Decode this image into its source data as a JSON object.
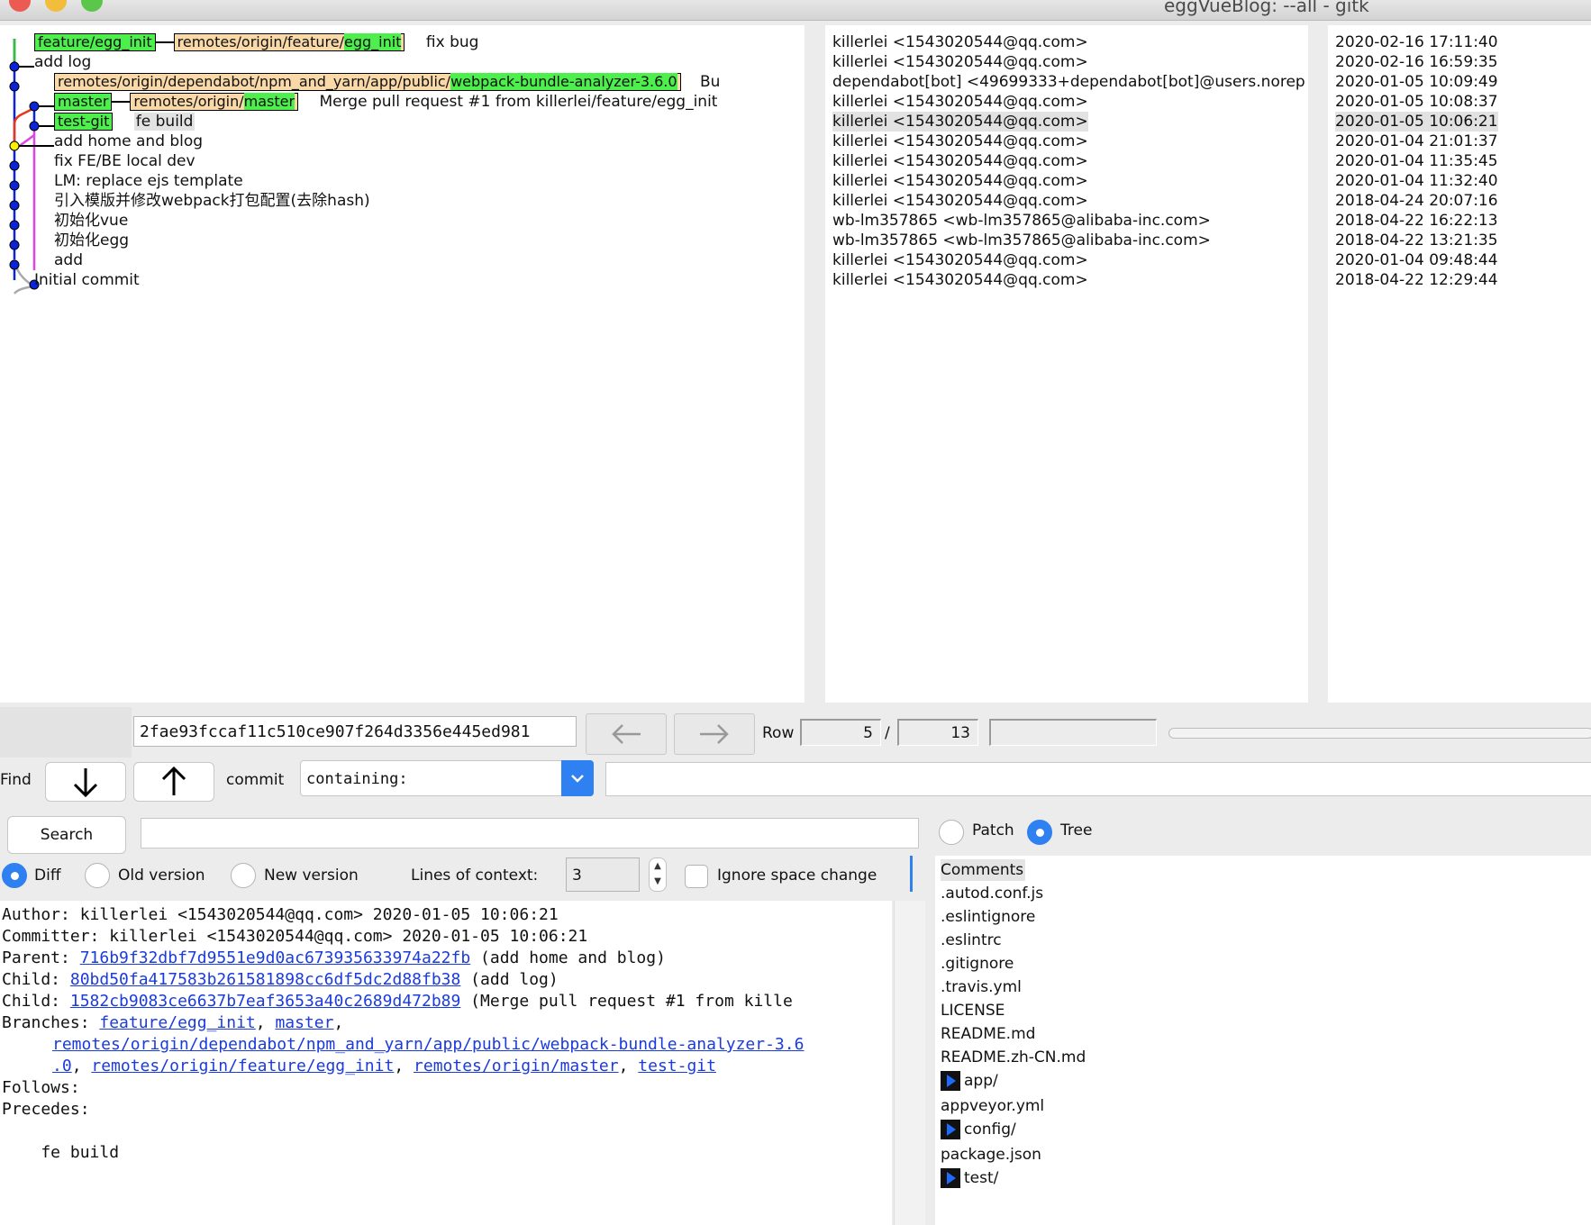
{
  "window": {
    "title": "eggVueBlog: --all - gitk"
  },
  "commits": [
    {
      "refs": [
        {
          "label": "feature/egg_init",
          "style": "green"
        },
        {
          "label_prefix": "remotes/origin/feature/",
          "label_main": "egg_init",
          "style": "peach"
        }
      ],
      "message": "fix bug",
      "author": "killerlei <1543020544@qq.com>",
      "date": "2020-02-16 17:11:40"
    },
    {
      "refs": [],
      "message": "add log",
      "author": "killerlei <1543020544@qq.com>",
      "date": "2020-02-16 16:59:35"
    },
    {
      "refs": [
        {
          "label_prefix": "remotes/origin/dependabot/npm_and_yarn/app/public/",
          "label_main": "webpack-bundle-analyzer-3.6.0",
          "style": "peach"
        }
      ],
      "message": "Bu",
      "author": "dependabot[bot] <49699333+dependabot[bot]@users.norep",
      "date": "2020-01-05 10:09:49"
    },
    {
      "refs": [
        {
          "label": "master",
          "style": "green"
        },
        {
          "label_prefix": "remotes/origin/",
          "label_main": "master",
          "style": "peach"
        }
      ],
      "message": "Merge pull request #1 from killerlei/feature/egg_init",
      "author": "killerlei <1543020544@qq.com>",
      "date": "2020-01-05 10:08:37"
    },
    {
      "refs": [
        {
          "label": "test-git",
          "style": "green"
        }
      ],
      "message": "fe build",
      "author": "killerlei <1543020544@qq.com>",
      "date": "2020-01-05 10:06:21",
      "selected": true
    },
    {
      "refs": [],
      "message": "add home and blog",
      "author": "killerlei <1543020544@qq.com>",
      "date": "2020-01-04 21:01:37"
    },
    {
      "refs": [],
      "message": "fix FE/BE local dev",
      "author": "killerlei <1543020544@qq.com>",
      "date": "2020-01-04 11:35:45"
    },
    {
      "refs": [],
      "message": "LM: replace ejs template",
      "author": "killerlei <1543020544@qq.com>",
      "date": "2020-01-04 11:32:40"
    },
    {
      "refs": [],
      "message": "引入模版并修改webpack打包配置(去除hash)",
      "author": "killerlei <1543020544@qq.com>",
      "date": "2018-04-24 20:07:16"
    },
    {
      "refs": [],
      "message": "初始化vue",
      "author": "wb-lm357865 <wb-lm357865@alibaba-inc.com>",
      "date": "2018-04-22 16:22:13"
    },
    {
      "refs": [],
      "message": "初始化egg",
      "author": "wb-lm357865 <wb-lm357865@alibaba-inc.com>",
      "date": "2018-04-22 13:21:35"
    },
    {
      "refs": [],
      "message": "add",
      "author": "killerlei <1543020544@qq.com>",
      "date": "2020-01-04 09:48:44"
    },
    {
      "refs": [],
      "message": "Initial commit",
      "author": "killerlei <1543020544@qq.com>",
      "date": "2018-04-22 12:29:44"
    }
  ],
  "toolbar": {
    "sha": "2fae93fccaf11c510ce907f264d3356e445ed981",
    "row_label": "Row",
    "row_current": "5",
    "row_sep": "/",
    "row_total": "13"
  },
  "find": {
    "label": "Find",
    "commit_label": "commit",
    "mode": "containing:",
    "search_button": "Search"
  },
  "view_options": {
    "patch": "Patch",
    "tree": "Tree",
    "selected_view": "Tree",
    "diff": "Diff",
    "old_version": "Old version",
    "new_version": "New version",
    "selected_diff": "Diff",
    "lines_context_label": "Lines of context:",
    "lines_context_value": "3",
    "ignore_space_label": "Ignore space change",
    "ignore_space_checked": false
  },
  "details": {
    "author": "Author: killerlei <1543020544@qq.com>  2020-01-05 10:06:21",
    "committer": "Committer: killerlei <1543020544@qq.com>  2020-01-05 10:06:21",
    "parent_label": "Parent: ",
    "parent_sha": "716b9f32dbf7d9551e9d0ac673935633974a22fb",
    "parent_msg": " (add home and blog)",
    "child1_label": "Child:  ",
    "child1_sha": "80bd50fa417583b261581898cc6df5dc2d88fb38",
    "child1_msg": " (add log)",
    "child2_label": "Child:  ",
    "child2_sha": "1582cb9083ce6637b7eaf3653a40c2689d472b89",
    "child2_msg": " (Merge pull request #1 from kille",
    "branches_label": "Branches: ",
    "branch1": "feature/egg_init",
    "branch2": "master",
    "branch3a": "remotes/origin/dependabot/npm_and_yarn/app/public/webpack-bundle-analyzer-3.6",
    "branch3b": ".0",
    "branch4": "remotes/origin/feature/egg_init",
    "branch5": "remotes/origin/master",
    "branch6": "test-git",
    "follows": "Follows:",
    "precedes": "Precedes:",
    "message": "    fe build"
  },
  "tree": {
    "items": [
      {
        "name": "Comments",
        "type": "header"
      },
      {
        "name": ".autod.conf.js",
        "type": "file"
      },
      {
        "name": ".eslintignore",
        "type": "file"
      },
      {
        "name": ".eslintrc",
        "type": "file"
      },
      {
        "name": ".gitignore",
        "type": "file"
      },
      {
        "name": ".travis.yml",
        "type": "file"
      },
      {
        "name": "LICENSE",
        "type": "file"
      },
      {
        "name": "README.md",
        "type": "file"
      },
      {
        "name": "README.zh-CN.md",
        "type": "file"
      },
      {
        "name": "app/",
        "type": "dir"
      },
      {
        "name": "appveyor.yml",
        "type": "file"
      },
      {
        "name": "config/",
        "type": "dir"
      },
      {
        "name": "package.json",
        "type": "file"
      },
      {
        "name": "test/",
        "type": "dir"
      }
    ]
  },
  "colors": {
    "local_branch": "#4cef4c",
    "remote_branch": "#fad9a8",
    "link": "#1a3bdd",
    "accent": "#2f80f0",
    "graph_blue": "#0b24d8",
    "graph_red": "#e8361c",
    "graph_magenta": "#e044e8",
    "graph_green": "#33c133"
  }
}
